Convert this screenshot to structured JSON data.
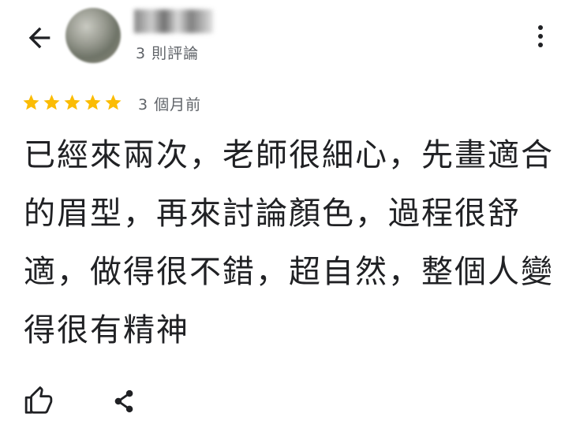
{
  "header": {
    "back_icon": "arrow-back-icon",
    "more_icon": "more-vert-icon",
    "reviewer": {
      "avatar": "blurred-photo",
      "name_obscured": true,
      "review_count": "3 則評論"
    }
  },
  "review": {
    "rating": 5,
    "max_rating": 5,
    "star_color": "#fbbc04",
    "date": "3 個月前",
    "text": "已經來兩次，老師很細心，先畫適合的眉型，再來討論顏色，過程很舒適，做得很不錯，超自然，整個人變得很有精神"
  },
  "actions": {
    "like_icon": "thumb-up-icon",
    "share_icon": "share-icon"
  }
}
